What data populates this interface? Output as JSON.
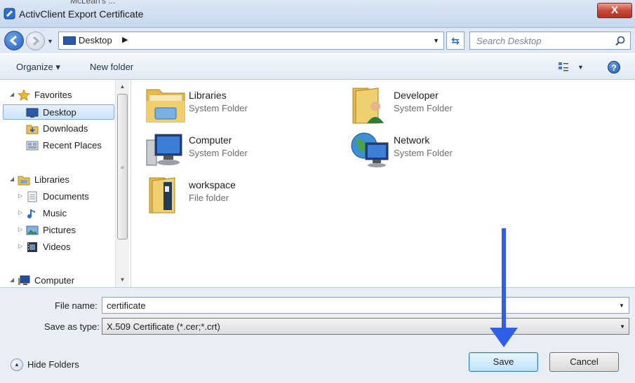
{
  "background_window": {
    "peek_text": "McLean's ..."
  },
  "titlebar": {
    "title": "ActivClient Export Certificate",
    "close_label": "X"
  },
  "address": {
    "location": "Desktop",
    "search_placeholder": "Search Desktop"
  },
  "toolbar": {
    "organize": "Organize ▾",
    "new_folder": "New folder",
    "help": "?"
  },
  "sidebar": {
    "favorites": "Favorites",
    "desktop": "Desktop",
    "downloads": "Downloads",
    "recent": "Recent Places",
    "libraries": "Libraries",
    "documents": "Documents",
    "music": "Music",
    "pictures": "Pictures",
    "videos": "Videos",
    "computer": "Computer"
  },
  "items": [
    {
      "name": "Libraries",
      "type": "System Folder",
      "icon": "libraries-icon"
    },
    {
      "name": "Developer",
      "type": "System Folder",
      "icon": "user-folder-icon"
    },
    {
      "name": "Computer",
      "type": "System Folder",
      "icon": "computer-icon"
    },
    {
      "name": "Network",
      "type": "System Folder",
      "icon": "network-icon"
    },
    {
      "name": "workspace",
      "type": "File folder",
      "icon": "folder-icon"
    }
  ],
  "form": {
    "file_name_label": "File name:",
    "file_name_value": "certificate",
    "save_type_label": "Save as type:",
    "save_type_value": "X.509 Certificate (*.cer;*.crt)"
  },
  "footer": {
    "hide_folders": "Hide Folders",
    "save": "Save",
    "cancel": "Cancel"
  },
  "colors": {
    "annotation_arrow": "#2f5fe8",
    "accent": "#3c7fb1"
  }
}
